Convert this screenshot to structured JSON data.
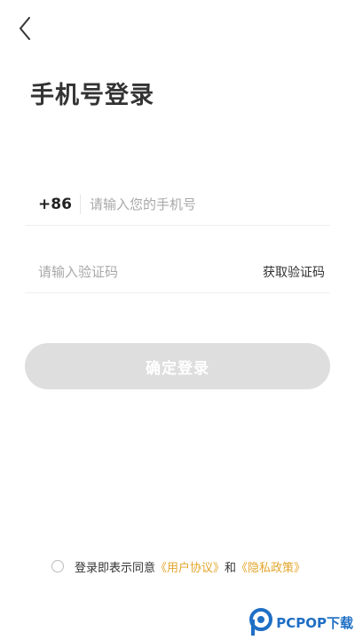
{
  "header": {
    "back_icon": "chevron-left-icon"
  },
  "page": {
    "title": "手机号登录"
  },
  "phone": {
    "country_code": "+86",
    "placeholder": "请输入您的手机号",
    "value": ""
  },
  "code": {
    "placeholder": "请输入验证码",
    "value": "",
    "get_code_label": "获取验证码"
  },
  "confirm": {
    "label": "确定登录"
  },
  "agreement": {
    "prefix": "登录即表示同意",
    "user_agreement": "《用户协议》",
    "and": "和",
    "privacy_policy": "《隐私政策》",
    "checked": false
  },
  "watermark": {
    "text": "PCPOP下载"
  },
  "colors": {
    "title": "#333333",
    "button_disabled": "#dedede",
    "link": "#e3a52c",
    "placeholder": "#a8a8a8",
    "divider": "#eeeeee",
    "watermark": "#1f6fc5"
  }
}
